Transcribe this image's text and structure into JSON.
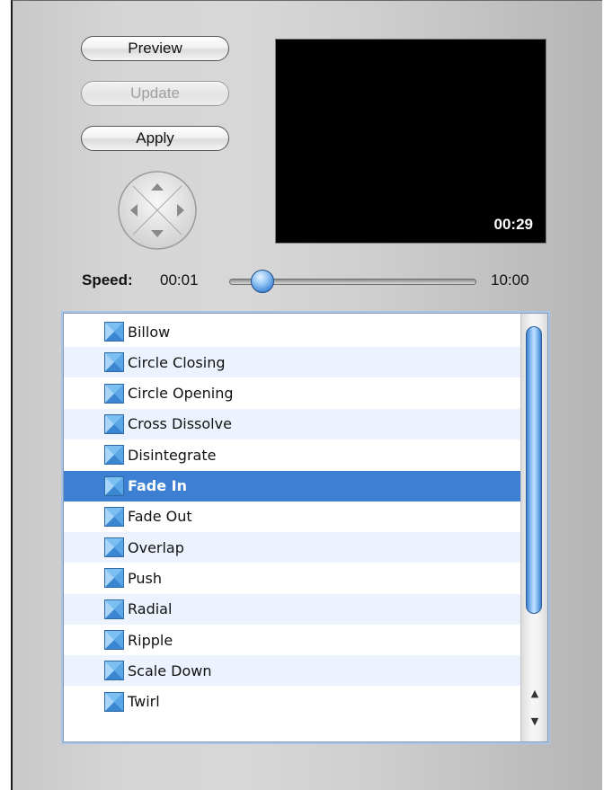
{
  "buttons": {
    "preview": "Preview",
    "update": "Update",
    "apply": "Apply"
  },
  "preview": {
    "timecode": "00:29"
  },
  "speed": {
    "label": "Speed:",
    "min": "00:01",
    "max": "10:00",
    "fraction": 0.04
  },
  "transitions": [
    "Billow",
    "Circle Closing",
    "Circle Opening",
    "Cross Dissolve",
    "Disintegrate",
    "Fade In",
    "Fade Out",
    "Overlap",
    "Push",
    "Radial",
    "Ripple",
    "Scale Down",
    "Twirl"
  ],
  "selected_index": 5,
  "icons": {
    "direction_pad": "direction-pad-icon",
    "transition": "transition-icon",
    "scroll_up": "scroll-up-arrow-icon",
    "scroll_down": "scroll-down-arrow-icon"
  },
  "colors": {
    "selection": "#3d80d3",
    "row_alt": "#edf3fe"
  }
}
